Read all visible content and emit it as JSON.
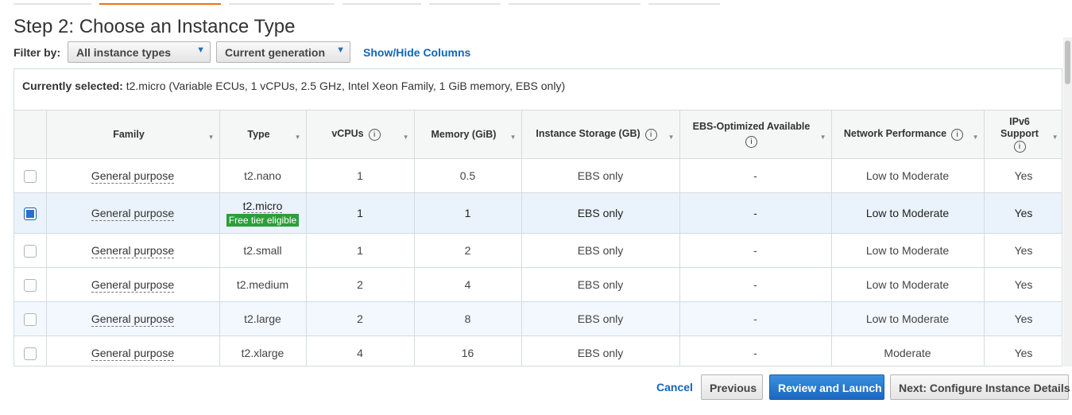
{
  "page_title": "Step 2: Choose an Instance Type",
  "filter": {
    "label": "Filter by:",
    "instance_types": "All instance types",
    "generation": "Current generation",
    "show_hide": "Show/Hide Columns"
  },
  "current_selection": {
    "label": "Currently selected:",
    "value": "t2.micro (Variable ECUs, 1 vCPUs, 2.5 GHz, Intel Xeon Family, 1 GiB memory, EBS only)"
  },
  "columns": {
    "family": "Family",
    "type": "Type",
    "vcpus": "vCPUs",
    "memory": "Memory (GiB)",
    "storage": "Instance Storage (GB)",
    "ebs": "EBS-Optimized Available",
    "network": "Network Performance",
    "ipv6_line1": "IPv6",
    "ipv6_line2": "Support"
  },
  "rows": [
    {
      "family": "General purpose",
      "type": "t2.nano",
      "vcpus": "1",
      "memory": "0.5",
      "storage": "EBS only",
      "ebs": "-",
      "network": "Low to Moderate",
      "ipv6": "Yes"
    },
    {
      "family": "General purpose",
      "type": "t2.micro",
      "badge": "Free tier eligible",
      "vcpus": "1",
      "memory": "1",
      "storage": "EBS only",
      "ebs": "-",
      "network": "Low to Moderate",
      "ipv6": "Yes"
    },
    {
      "family": "General purpose",
      "type": "t2.small",
      "vcpus": "1",
      "memory": "2",
      "storage": "EBS only",
      "ebs": "-",
      "network": "Low to Moderate",
      "ipv6": "Yes"
    },
    {
      "family": "General purpose",
      "type": "t2.medium",
      "vcpus": "2",
      "memory": "4",
      "storage": "EBS only",
      "ebs": "-",
      "network": "Low to Moderate",
      "ipv6": "Yes"
    },
    {
      "family": "General purpose",
      "type": "t2.large",
      "vcpus": "2",
      "memory": "8",
      "storage": "EBS only",
      "ebs": "-",
      "network": "Low to Moderate",
      "ipv6": "Yes"
    },
    {
      "family": "General purpose",
      "type": "t2.xlarge",
      "vcpus": "4",
      "memory": "16",
      "storage": "EBS only",
      "ebs": "-",
      "network": "Moderate",
      "ipv6": "Yes"
    }
  ],
  "info_icon": "i",
  "footer": {
    "cancel": "Cancel",
    "previous": "Previous",
    "review_launch": "Review and Launch",
    "next": "Next: Configure Instance Details"
  },
  "colors": {
    "accent_tab": "#ec7211",
    "link": "#1166bb",
    "primary_button": "#1d67c1",
    "free_tier_badge": "#2b9f3a",
    "selected_row": "#eaf3fb"
  }
}
